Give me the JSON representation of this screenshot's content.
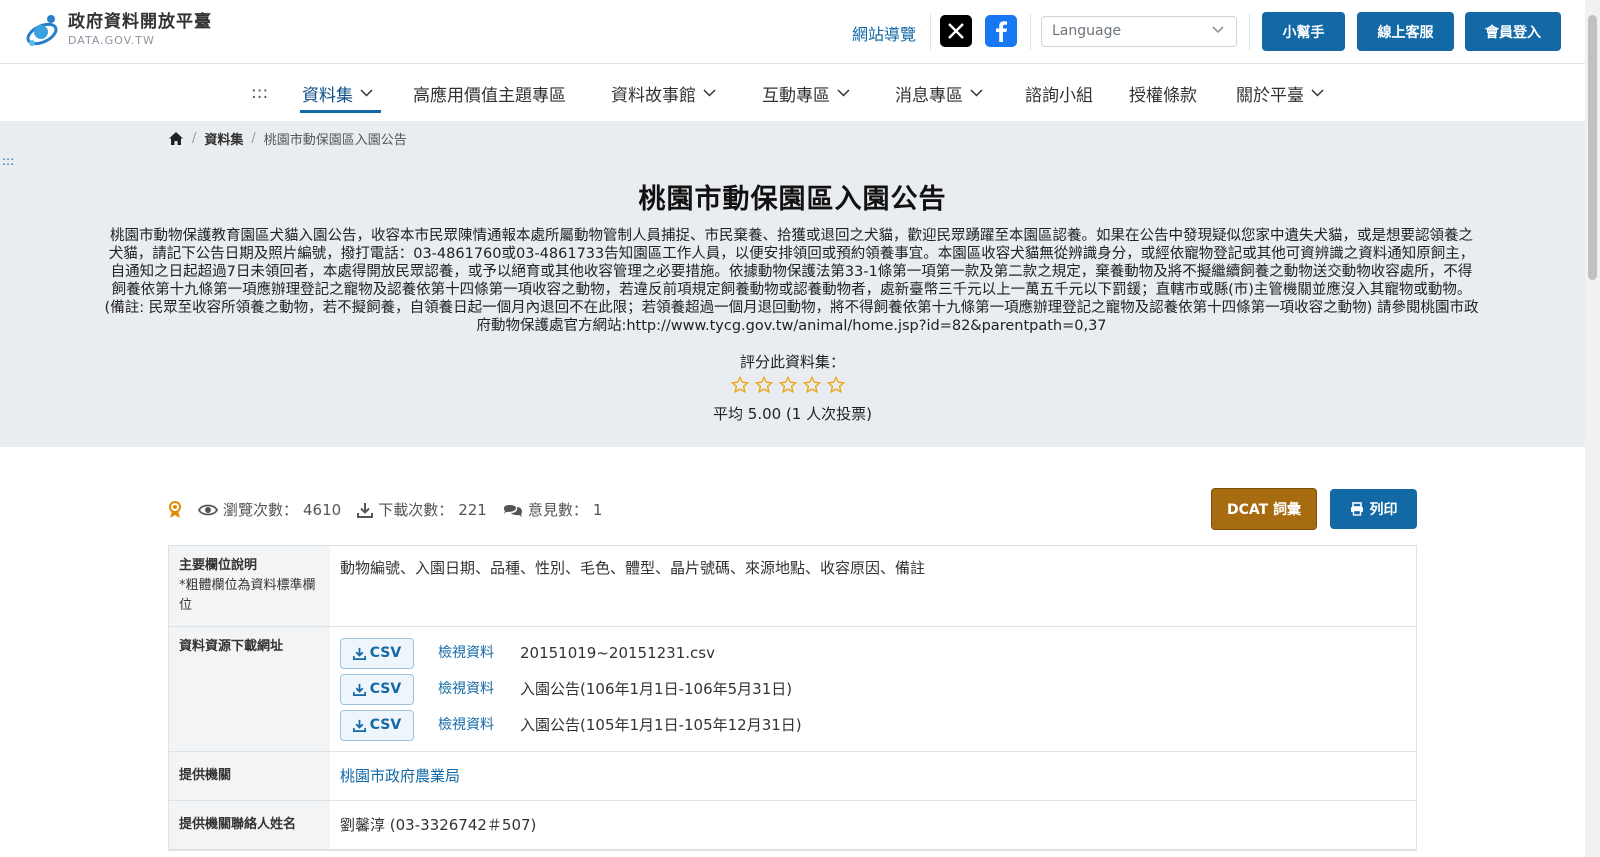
{
  "header": {
    "logo_title": "政府資料開放平臺",
    "logo_sub": "DATA.GOV.TW",
    "sitemap": "網站導覽",
    "language_placeholder": "Language",
    "buttons": [
      "小幫手",
      "線上客服",
      "會員登入"
    ],
    "social": [
      "x-icon",
      "facebook-icon"
    ]
  },
  "nav": {
    "menu_glyph": ":::",
    "items": [
      {
        "label": "資料集",
        "dropdown": true,
        "active": true
      },
      {
        "label": "高應用價值主題專區",
        "dropdown": false
      },
      {
        "label": "資料故事館",
        "dropdown": true
      },
      {
        "label": "互動專區",
        "dropdown": true
      },
      {
        "label": "消息專區",
        "dropdown": true
      },
      {
        "label": "諮詢小組",
        "dropdown": false
      },
      {
        "label": "授權條款",
        "dropdown": false
      },
      {
        "label": "關於平臺",
        "dropdown": true
      }
    ]
  },
  "breadcrumb": {
    "section": "資料集",
    "current": "桃園市動保園區入園公告"
  },
  "hero": {
    "side_glyph": ":::",
    "title": "桃園市動保園區入園公告",
    "description": "桃園市動物保護教育園區犬貓入園公告，收容本市民眾陳情通報本處所屬動物管制人員捕捉、市民棄養、拾獲或退回之犬貓，歡迎民眾踴躍至本園區認養。如果在公告中發現疑似您家中遺失犬貓，或是想要認領養之犬貓，請記下公告日期及照片編號，撥打電話：03-4861760或03-4861733告知園區工作人員，以便安排領回或預約領養事宜。本園區收容犬貓無從辨識身分，或經依寵物登記或其他可資辨識之資料通知原飼主，自通知之日起超過7日未領回者，本處得開放民眾認養，或予以絕育或其他收容管理之必要措施。依據動物保護法第33-1條第一項第一款及第二款之規定，棄養動物及將不擬繼續飼養之動物送交動物收容處所，不得飼養依第十九條第一項應辦理登記之寵物及認養依第十四條第一項收容之動物，若違反前項規定飼養動物或認養動物者，處新臺幣三千元以上一萬五千元以下罰鍰；直轄市或縣(市)主管機關並應沒入其寵物或動物。 (備註: 民眾至收容所領養之動物，若不擬飼養，自領養日起一個月內退回不在此限；若領養超過一個月退回動物，將不得飼養依第十九條第一項應辦理登記之寵物及認養依第十四條第一項收容之動物) 請參閱桃園市政府動物保護處官方網站:http://www.tycg.gov.tw/animal/home.jsp?id=82&parentpath=0,37",
    "rate_label": "評分此資料集：",
    "star_count": 5,
    "rate_avg": "平均 5.00 (1 人次投票)",
    "star_color": "#f0a000"
  },
  "stats": {
    "views_label": "瀏覽次數：",
    "views": "4610",
    "downloads_label": "下載次數：",
    "downloads": "221",
    "comments_label": "意見數：",
    "comments": "1",
    "dcat_button": "DCAT 詞彙",
    "print_button": "列印"
  },
  "info": {
    "fields_label": "主要欄位說明",
    "fields_note": "*粗體欄位為資料標準欄位",
    "fields_value": "動物編號、入園日期、品種、性別、毛色、體型、晶片號碼、來源地點、收容原因、備註",
    "resources_label": "資料資源下載網址",
    "resources": [
      {
        "format": "CSV",
        "view": "檢視資料",
        "name": "20151019~20151231.csv"
      },
      {
        "format": "CSV",
        "view": "檢視資料",
        "name": "入園公告(106年1月1日-106年5月31日)"
      },
      {
        "format": "CSV",
        "view": "檢視資料",
        "name": "入園公告(105年1月1日-105年12月31日)"
      }
    ],
    "provider_label": "提供機關",
    "provider_value": "桃園市政府農業局",
    "contact_label": "提供機關聯絡人姓名",
    "contact_value": "劉馨淳 (03-3326742＃507)"
  },
  "colors": {
    "primary": "#1369a6",
    "dcat": "#a86c10",
    "hero_bg": "#e9edf1"
  }
}
